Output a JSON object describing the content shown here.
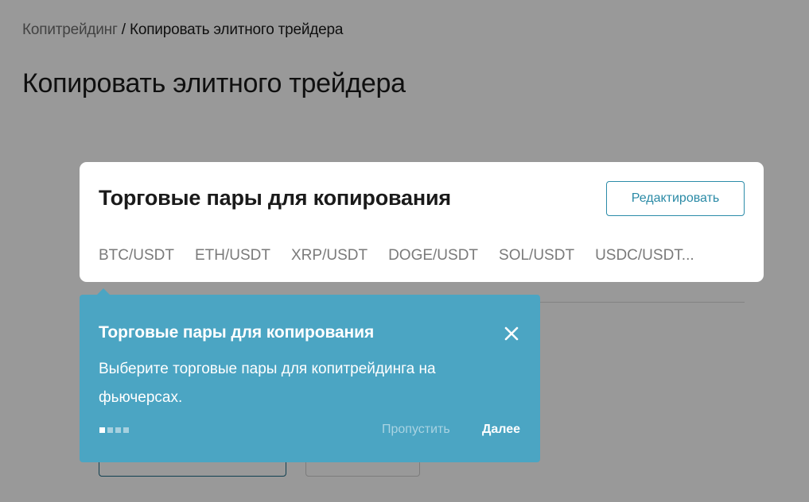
{
  "breadcrumb": {
    "parent": "Копитрейдинг",
    "separator": " / ",
    "current": "Копировать элитного трейдера"
  },
  "page": {
    "title": "Копировать элитного трейдера"
  },
  "pairs_card": {
    "title": "Торговые пары для копирования",
    "edit_label": "Редактировать",
    "pairs": [
      "BTC/USDT",
      "ETH/USDT",
      "XRP/USDT",
      "DOGE/USDT",
      "SOL/USDT",
      "USDC/USDT..."
    ]
  },
  "tooltip": {
    "title": "Торговые пары для копирования",
    "description": "Выберите торговые пары для копитрейдинга на фьючерсах.",
    "skip_label": "Пропустить",
    "next_label": "Далее",
    "step_current": 1,
    "step_total": 4
  },
  "colors": {
    "accent": "#4ba5c3",
    "accent_dark": "#2a8aa6"
  }
}
